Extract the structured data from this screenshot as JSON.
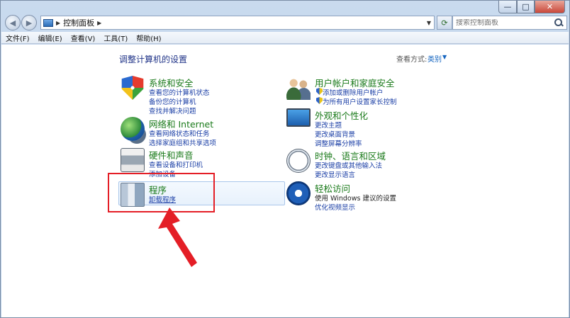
{
  "window": {
    "caption": {
      "minimize": "—",
      "maximize": "□",
      "close": "✕"
    }
  },
  "address_bar": {
    "location": "控制面板",
    "separator": "▶",
    "search_placeholder": "搜索控制面板"
  },
  "menu": [
    "文件(F)",
    "编辑(E)",
    "查看(V)",
    "工具(T)",
    "帮助(H)"
  ],
  "content": {
    "title": "调整计算机的设置",
    "view_by_label": "查看方式:",
    "view_by_value": "类别"
  },
  "categories": {
    "system_security": {
      "title": "系统和安全",
      "links": [
        "查看您的计算机状态",
        "备份您的计算机",
        "查找并解决问题"
      ]
    },
    "network": {
      "title": "网络和 Internet",
      "links": [
        "查看网络状态和任务",
        "选择家庭组和共享选项"
      ]
    },
    "hardware": {
      "title": "硬件和声音",
      "links": [
        "查看设备和打印机",
        "添加设备"
      ]
    },
    "programs": {
      "title": "程序",
      "links": [
        "卸载程序"
      ]
    },
    "user_accounts": {
      "title": "用户帐户和家庭安全",
      "links": [
        "添加或删除用户帐户",
        "为所有用户设置家长控制"
      ]
    },
    "appearance": {
      "title": "外观和个性化",
      "links": [
        "更改主题",
        "更改桌面背景",
        "调整屏幕分辨率"
      ]
    },
    "clock_region": {
      "title": "时钟、语言和区域",
      "links": [
        "更改键盘或其他输入法",
        "更改显示语言"
      ]
    },
    "ease_access": {
      "title": "轻松访问",
      "links": [
        "使用 Windows 建议的设置",
        "优化视频显示"
      ]
    }
  },
  "annotation": {
    "highlight_color": "#e41e26"
  }
}
